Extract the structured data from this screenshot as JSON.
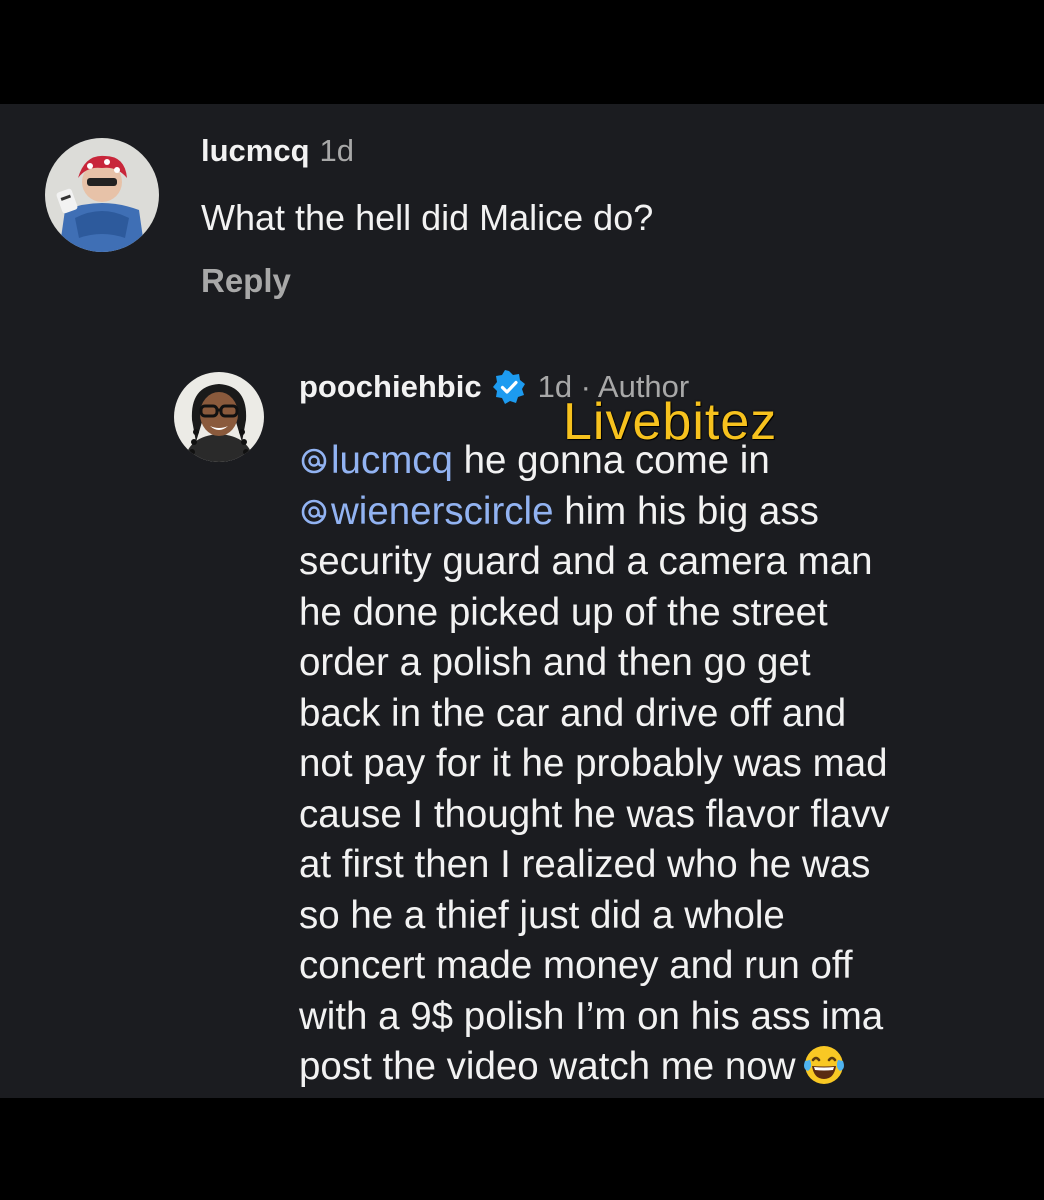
{
  "comment1": {
    "username": "lucmcq",
    "time": "1d",
    "text": "What the hell did Malice do?",
    "reply_label": "Reply"
  },
  "comment2": {
    "username": "poochiehbic",
    "meta": "1d · Author",
    "mention1": "lucmcq",
    "line1_rest": " he gonna come in",
    "mention2": "wienerscircle",
    "line2_rest": " him his big ass",
    "lines": [
      "security guard and a camera man",
      "he done picked up of the street",
      "order a polish and then go get",
      "back in the car and drive off and",
      "not pay for it he probably was mad",
      "cause I thought he was flavor flavv",
      "at first then I realized who he was",
      "so he a thief just did a whole",
      "concert made money and run off",
      "with a 9$ polish I’m on his ass ima",
      "post the video watch me now"
    ],
    "emoji": "face-with-tears-of-joy"
  },
  "watermark": "Livebitez",
  "colors": {
    "background": "#1b1c20",
    "mention": "#92b3f2",
    "verified": "#1d9bf0",
    "watermark": "#f7c21e"
  }
}
